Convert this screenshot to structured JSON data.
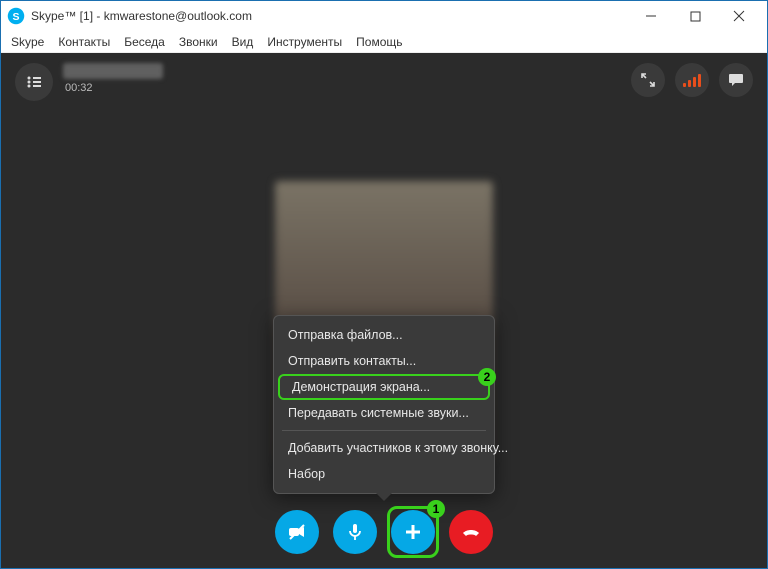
{
  "titlebar": {
    "title": "Skype™ [1] - kmwarestone@outlook.com"
  },
  "menu": {
    "items": [
      "Skype",
      "Контакты",
      "Беседа",
      "Звонки",
      "Вид",
      "Инструменты",
      "Помощь"
    ]
  },
  "call": {
    "duration": "00:32"
  },
  "popup": {
    "items": [
      {
        "label": "Отправка файлов...",
        "sep_after": false
      },
      {
        "label": "Отправить контакты...",
        "sep_after": false
      },
      {
        "label": "Демонстрация экрана...",
        "sep_after": false,
        "highlight": true,
        "badge": "2"
      },
      {
        "label": "Передавать системные звуки...",
        "sep_after": true
      },
      {
        "label": "Добавить участников к этому звонку...",
        "sep_after": false
      },
      {
        "label": "Набор",
        "sep_after": false
      }
    ]
  },
  "controls": {
    "plus_badge": "1"
  }
}
